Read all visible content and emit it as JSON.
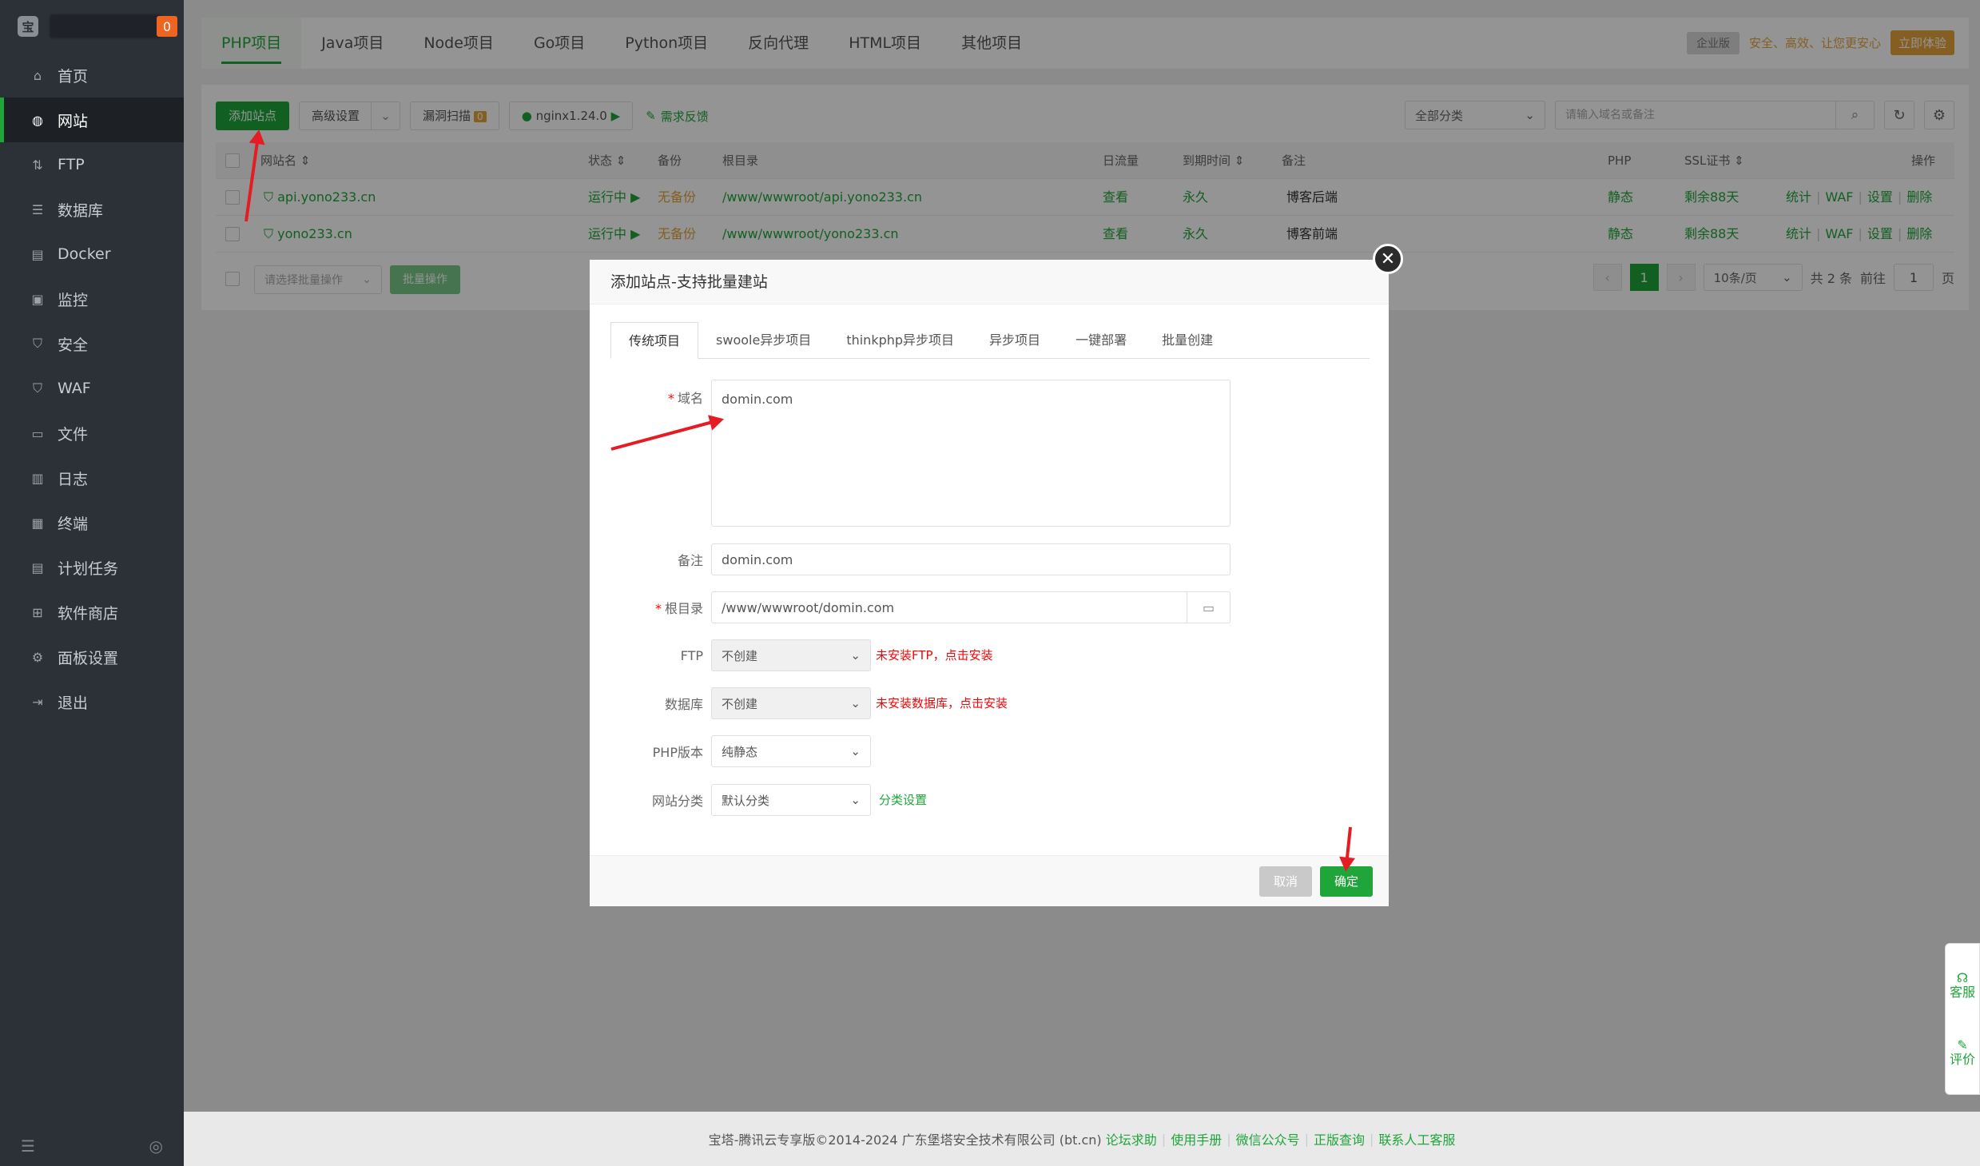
{
  "sidebar": {
    "badge": "0",
    "items": [
      {
        "label": "首页",
        "icon": "home-icon"
      },
      {
        "label": "网站",
        "icon": "globe-icon",
        "active": true
      },
      {
        "label": "FTP",
        "icon": "ftp-icon"
      },
      {
        "label": "数据库",
        "icon": "database-icon"
      },
      {
        "label": "Docker",
        "icon": "docker-icon"
      },
      {
        "label": "监控",
        "icon": "monitor-icon"
      },
      {
        "label": "安全",
        "icon": "shield-icon"
      },
      {
        "label": "WAF",
        "icon": "waf-shield-icon"
      },
      {
        "label": "文件",
        "icon": "folder-icon"
      },
      {
        "label": "日志",
        "icon": "log-icon"
      },
      {
        "label": "终端",
        "icon": "terminal-icon"
      },
      {
        "label": "计划任务",
        "icon": "task-icon"
      },
      {
        "label": "软件商店",
        "icon": "store-icon"
      },
      {
        "label": "面板设置",
        "icon": "gear-icon"
      },
      {
        "label": "退出",
        "icon": "logout-icon"
      }
    ]
  },
  "tabs": [
    "PHP项目",
    "Java项目",
    "Node项目",
    "Go项目",
    "Python项目",
    "反向代理",
    "HTML项目",
    "其他项目"
  ],
  "promo": {
    "badge": "企业版",
    "text": "安全、高效、让您更安心",
    "button": "立即体验"
  },
  "toolbar": {
    "add_site": "添加站点",
    "advanced": "高级设置",
    "vuln_scan": "漏洞扫描",
    "vuln_count": "0",
    "nginx": "nginx1.24.0",
    "feedback": "需求反馈",
    "category": "全部分类",
    "search_placeholder": "请输入域名或备注"
  },
  "table": {
    "headers": {
      "name": "网站名",
      "status": "状态",
      "backup": "备份",
      "root": "根目录",
      "traffic": "日流量",
      "expire": "到期时间",
      "note": "备注",
      "php": "PHP",
      "ssl": "SSL证书",
      "ops": "操作"
    },
    "rows": [
      {
        "name": "api.yono233.cn",
        "status": "运行中",
        "backup": "无备份",
        "root": "/www/wwwroot/api.yono233.cn",
        "traffic": "查看",
        "expire": "永久",
        "note": "博客后端",
        "php": "静态",
        "ssl": "剩余88天",
        "op1": "统计",
        "op2": "WAF",
        "op3": "设置",
        "op4": "删除"
      },
      {
        "name": "yono233.cn",
        "status": "运行中",
        "backup": "无备份",
        "root": "/www/wwwroot/yono233.cn",
        "traffic": "查看",
        "expire": "永久",
        "note": "博客前端",
        "php": "静态",
        "ssl": "剩余88天",
        "op1": "统计",
        "op2": "WAF",
        "op3": "设置",
        "op4": "删除"
      }
    ]
  },
  "batch": {
    "select": "请选择批量操作",
    "button": "批量操作"
  },
  "pager": {
    "current": "1",
    "per_page": "10条/页",
    "total": "共 2 条",
    "goto": "前往",
    "page_input": "1",
    "page_suffix": "页"
  },
  "footer": {
    "copyright": "宝塔-腾讯云专享版©2014-2024 广东堡塔安全技术有限公司 (bt.cn)",
    "links": [
      "论坛求助",
      "使用手册",
      "微信公众号",
      "正版查询",
      "联系人工客服"
    ]
  },
  "side_float": {
    "service": "客服",
    "rate": "评价"
  },
  "dialog": {
    "title": "添加站点-支持批量建站",
    "tabs": [
      "传统项目",
      "swoole异步项目",
      "thinkphp异步项目",
      "异步项目",
      "一键部署",
      "批量创建"
    ],
    "domain_label": "域名",
    "domain_value": "domin.com",
    "note_label": "备注",
    "note_value": "domin.com",
    "root_label": "根目录",
    "root_value": "/www/wwwroot/domin.com",
    "ftp_label": "FTP",
    "ftp_value": "不创建",
    "ftp_warn": "未安装FTP，点击安装",
    "db_label": "数据库",
    "db_value": "不创建",
    "db_warn": "未安装数据库，点击安装",
    "php_label": "PHP版本",
    "php_value": "纯静态",
    "cat_label": "网站分类",
    "cat_value": "默认分类",
    "cat_link": "分类设置",
    "cancel": "取消",
    "confirm": "确定"
  },
  "colors": {
    "accent": "#20a53a",
    "sidebar": "#2c3138",
    "warning": "#e6a23c",
    "danger": "#ef0808",
    "arrow": "#e51c23"
  }
}
